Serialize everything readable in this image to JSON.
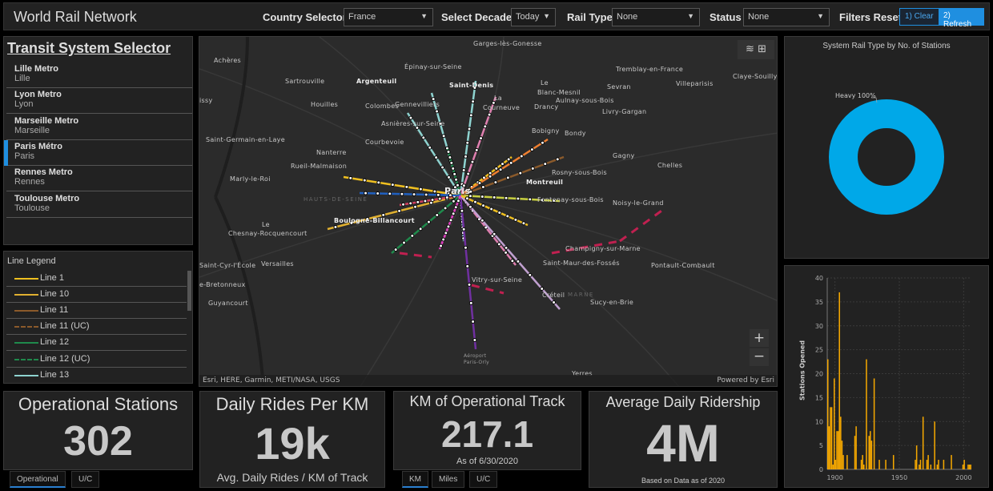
{
  "header": {
    "title": "World Rail Network",
    "country": {
      "label": "Country Selector",
      "value": "France"
    },
    "decade": {
      "label": "Select Decade",
      "value": "Today"
    },
    "rail_type": {
      "label": "Rail Type",
      "value": "None"
    },
    "status": {
      "label": "Status",
      "value": "None"
    },
    "filters_reset": {
      "label": "Filters Reset",
      "clear": "1) Clear",
      "refresh": "2) Refresh"
    }
  },
  "accent": "#1f8fe0",
  "systems": {
    "title": "Transit System Selector",
    "selected": "Paris Métro",
    "items": [
      {
        "name": "Lille Metro",
        "city": "Lille"
      },
      {
        "name": "Lyon Metro",
        "city": "Lyon"
      },
      {
        "name": "Marseille Metro",
        "city": "Marseille"
      },
      {
        "name": "Paris Métro",
        "city": "Paris"
      },
      {
        "name": "Rennes Metro",
        "city": "Rennes"
      },
      {
        "name": "Toulouse Metro",
        "city": "Toulouse"
      }
    ]
  },
  "legend": {
    "title": "Line Legend",
    "items": [
      {
        "label": "Line 1",
        "color": "#f0c020",
        "style": "solid"
      },
      {
        "label": "Line 10",
        "color": "#e0b030",
        "style": "solid"
      },
      {
        "label": "Line 11",
        "color": "#8b5a2b",
        "style": "solid"
      },
      {
        "label": "Line 11 (UC)",
        "color": "#8b5a2b",
        "style": "dashed"
      },
      {
        "label": "Line 12",
        "color": "#1f8a4c",
        "style": "solid"
      },
      {
        "label": "Line 12 (UC)",
        "color": "#1f8a4c",
        "style": "dashed"
      },
      {
        "label": "Line 13",
        "color": "#8ed3d0",
        "style": "solid"
      }
    ]
  },
  "map": {
    "attribution": "Esri, HERE, Garmin, METI/NASA, USGS",
    "powered": "Powered by Esri",
    "zoom_in": "+",
    "zoom_out": "−",
    "places": [
      "Achères",
      "Sartrouville",
      "Argenteuil",
      "Épinay-sur-Seine",
      "Saint-Denis",
      "issy",
      "Houilles",
      "Colombes",
      "Gennevilliers",
      "Asnières-sur-Seine",
      "Saint-Germain-en-Laye",
      "Courbevoie",
      "Nanterre",
      "Rueil-Malmaison",
      "Marly-le-Roi",
      "HAUTS-DE-SEINE",
      "Paris",
      "Garges-lès-Gonesse",
      "Tremblay-en-France",
      "Le",
      "Blanc-Mesnil",
      "La",
      "Courneuve",
      "Sevran",
      "Villeparisis",
      "Claye-Souilly",
      "Aulnay-sous-Bois",
      "Drancy",
      "Livry-Gargan",
      "Bobigny",
      "Bondy",
      "Gagny",
      "Chelles",
      "Rosny-sous-Bois",
      "Montreuil",
      "Fontenay-sous-Bois",
      "Noisy-le-Grand",
      "Boulogne-Billancourt",
      "Le",
      "Chesnay-Rocquencourt",
      "Saint-Cyr-l'École",
      "Versailles",
      "e-Bretonneux",
      "Guyancourt",
      "Aéroport",
      "Paris-Orly",
      "Champigny-sur-Marne",
      "Saint-Maur-des-Fossés",
      "Pontault-Combault",
      "Vitry-sur-Seine",
      "Créteil",
      "MARNE",
      "Sucy-en-Brie",
      "Yerres"
    ]
  },
  "cards": {
    "stations": {
      "title": "Operational Stations",
      "value": "302",
      "tabs": [
        "Operational",
        "U/C"
      ]
    },
    "rides_per_km": {
      "title": "Daily Rides Per KM",
      "value": "19k",
      "subtitle": "Avg. Daily Rides / KM of Track"
    },
    "track": {
      "title": "KM of Operational Track",
      "value": "217.1",
      "subtitle": "As of 6/30/2020",
      "tabs": [
        "KM",
        "Miles",
        "U/C"
      ]
    },
    "ridership": {
      "title": "Average Daily Ridership",
      "value": "4M",
      "subtitle": "Based on Data as of 2020"
    }
  },
  "chart_data": [
    {
      "type": "pie",
      "title": "System Rail Type by No. of Stations",
      "donut": true,
      "slices": [
        {
          "label": "Heavy 100%",
          "name": "Heavy",
          "value": 100,
          "color": "#00a8e8"
        }
      ]
    },
    {
      "type": "bar",
      "title": "",
      "xlabel": "",
      "ylabel": "Stations Opened",
      "color": "#f5a800",
      "ylim": [
        0,
        40
      ],
      "yticks": [
        0,
        5,
        10,
        15,
        20,
        25,
        30,
        35,
        40
      ],
      "xticks": [
        1900,
        1950,
        2000
      ],
      "xlim": [
        1894,
        2006
      ],
      "grid": true,
      "x": [
        1894,
        1895,
        1896,
        1897,
        1898,
        1899,
        1900,
        1901,
        1902,
        1903,
        1904,
        1905,
        1906,
        1909,
        1915,
        1916,
        1920,
        1921,
        1922,
        1924,
        1926,
        1927,
        1928,
        1930,
        1934,
        1939,
        1945,
        1962,
        1963,
        1965,
        1966,
        1968,
        1971,
        1972,
        1974,
        1977,
        1979,
        1980,
        1984,
        1990,
        1999,
        2000,
        2003,
        2004,
        2005
      ],
      "values": [
        23,
        9,
        13,
        13,
        1,
        19,
        2,
        8,
        8,
        37,
        11,
        6,
        3,
        3,
        7,
        9,
        2,
        3,
        1,
        23,
        7,
        8,
        6,
        19,
        2,
        2,
        3,
        2,
        5,
        1,
        2,
        11,
        2,
        3,
        1,
        10,
        1,
        2,
        2,
        3,
        1,
        2,
        1,
        1,
        1
      ]
    }
  ]
}
